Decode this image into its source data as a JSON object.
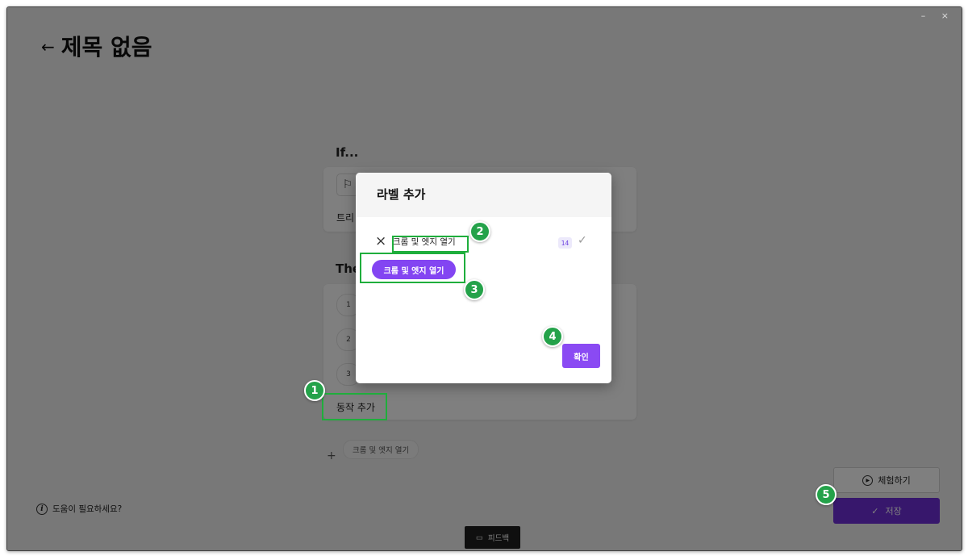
{
  "window": {
    "controls": "– ×"
  },
  "page": {
    "back_arrow": "←",
    "title": "제목 없음"
  },
  "if_section": {
    "label": "If...",
    "flag_icon": "flag-icon",
    "trigger_text": "트리"
  },
  "then_section": {
    "label": "The",
    "steps": [
      "1",
      "2",
      "3"
    ],
    "add_action_label": "동작 추가"
  },
  "added_label_chip": "크롬 및 엣지 열기",
  "help": {
    "icon": "i",
    "text": "도움이 필요하세요?"
  },
  "buttons": {
    "try": "체험하기",
    "save": "저장",
    "feedback": "피드백"
  },
  "modal": {
    "title": "라벨 추가",
    "input_value": "크롬 및 엣지 열기",
    "char_count": "14",
    "preview_chip": "크롬 및 엣지 열기",
    "confirm": "확인"
  },
  "annotations": [
    "1",
    "2",
    "3",
    "4",
    "5"
  ],
  "colors": {
    "accent": "#8a4af3",
    "save": "#6e2fd8",
    "annotation": "#24a24a"
  }
}
